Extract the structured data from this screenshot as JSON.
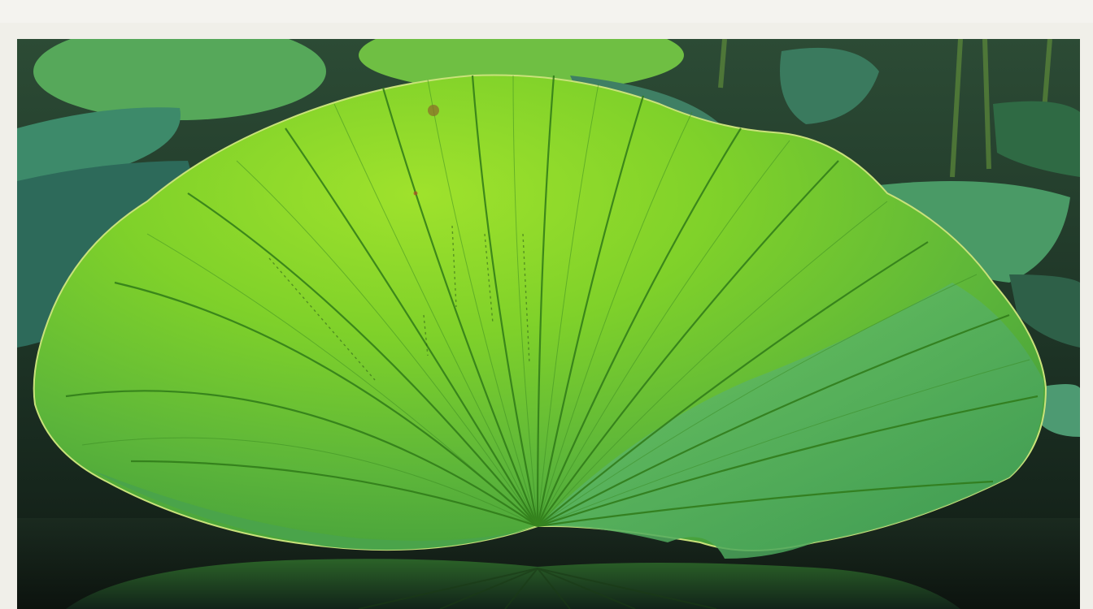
{
  "image": {
    "subject": "",
    "colors": {
      "leaf_bright": "#7fd12a",
      "leaf_mid": "#5db52a",
      "leaf_dark": "#2e7d1f",
      "vein": "#2f7a18",
      "water": "#14201a",
      "frame": "#f0efe9",
      "background_leaf": "#3f8a67"
    }
  }
}
